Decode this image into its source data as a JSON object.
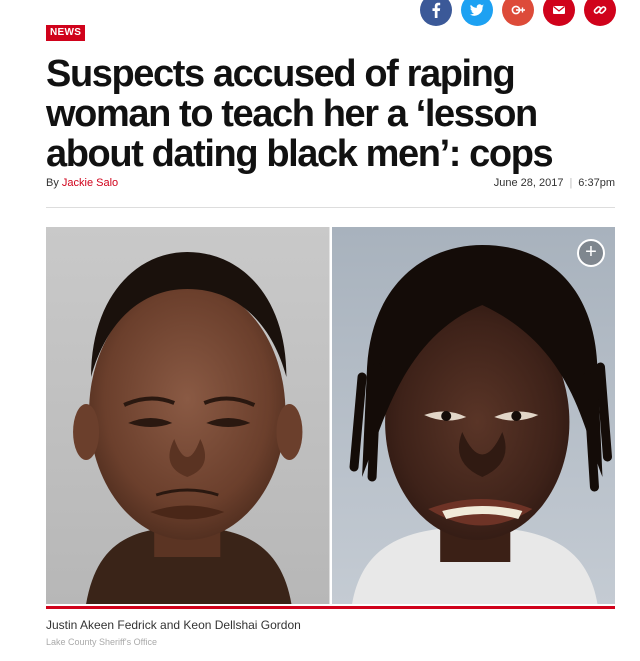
{
  "share": {
    "buttons": [
      {
        "name": "facebook-share-button",
        "icon": "facebook-icon",
        "color": "#3b5998",
        "glyph": "f"
      },
      {
        "name": "twitter-share-button",
        "icon": "twitter-icon",
        "color": "#1da1f2",
        "glyph": ""
      },
      {
        "name": "googleplus-share-button",
        "icon": "google-plus-icon",
        "color": "#dd4b39",
        "glyph": "G+"
      },
      {
        "name": "email-share-button",
        "icon": "mail-icon",
        "color": "#d0021b",
        "glyph": ""
      },
      {
        "name": "link-share-button",
        "icon": "link-icon",
        "color": "#d0021b",
        "glyph": ""
      }
    ]
  },
  "article": {
    "section_badge": "NEWS",
    "headline": "Suspects accused of raping woman to teach her a ‘lesson about dating black men’: cops",
    "by_prefix": "By",
    "author": "Jackie Salo",
    "date": "June 28, 2017",
    "date_separator": "|",
    "time": "6:37pm"
  },
  "photo": {
    "expand_glyph": "+",
    "caption": "Justin Akeen Fedrick and Keon Dellshai Gordon",
    "credit": "Lake County Sheriff's Office"
  },
  "colors": {
    "accent": "#d0021b",
    "text": "#111111"
  }
}
